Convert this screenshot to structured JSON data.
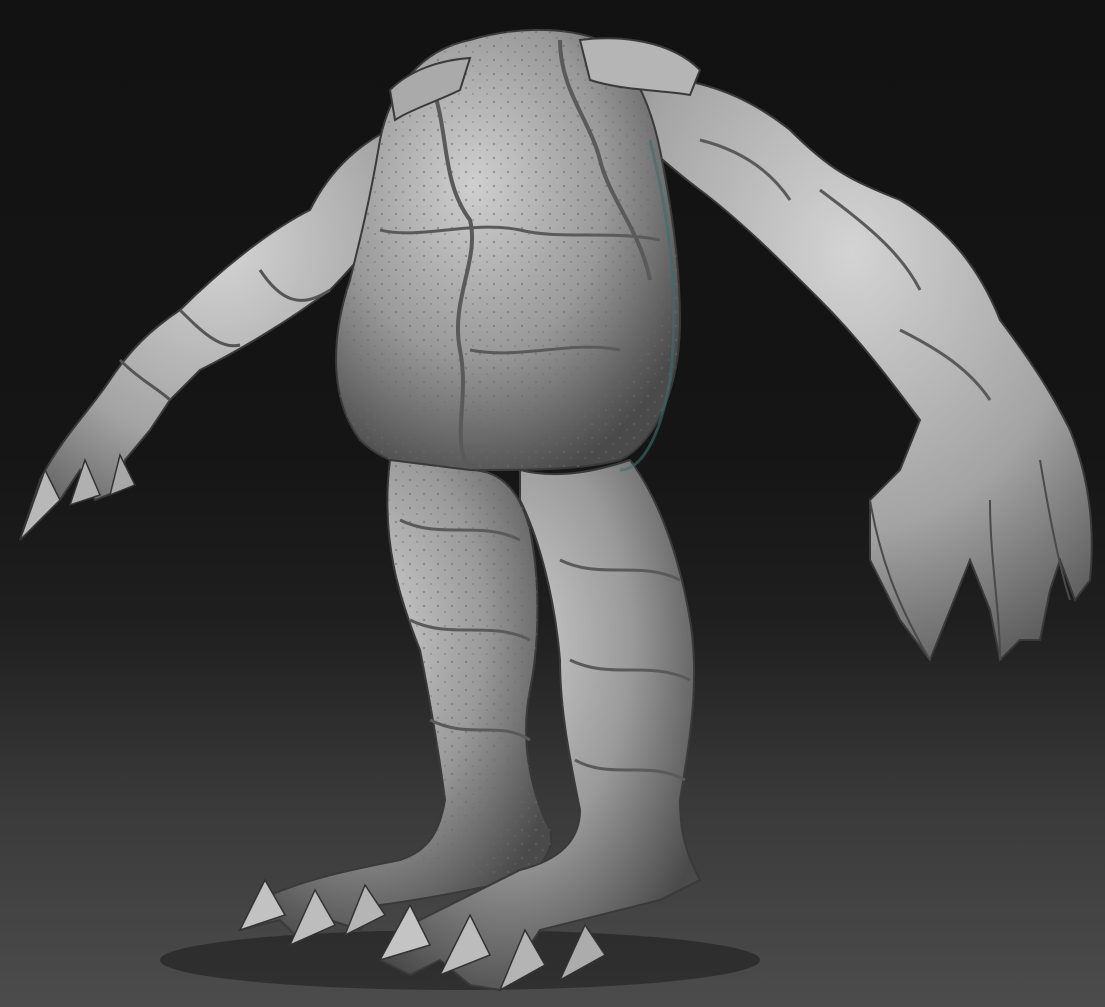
{
  "scene": {
    "subject": "creature-sculpt",
    "material": "matcap-gray",
    "colors": {
      "skin_light": "#cfcfcf",
      "skin_mid": "#9a9a9a",
      "skin_dark": "#4a4a4a",
      "rim_light": "#3a6f6a",
      "background_top": "#121212",
      "background_bottom": "#4c4c4c"
    }
  }
}
